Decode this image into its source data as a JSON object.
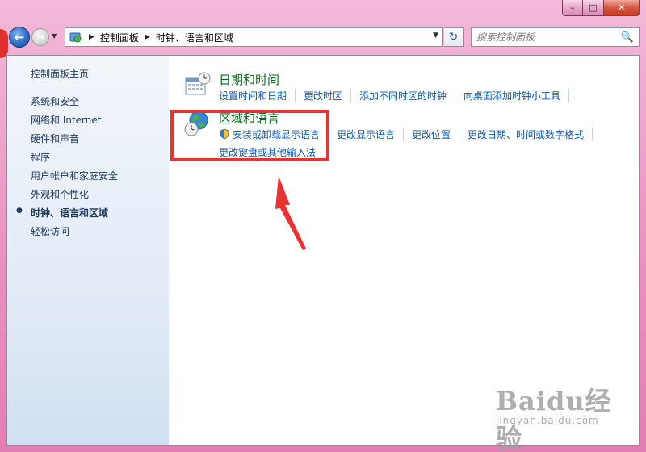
{
  "window": {
    "caption": {
      "minimize": "–",
      "maximize": "□",
      "close": "✕"
    }
  },
  "navigation": {
    "back_icon": "back-arrow-icon",
    "forward_icon": "forward-arrow-icon",
    "breadcrumbs": [
      "控制面板",
      "时钟、语言和区域"
    ],
    "search_placeholder": "搜索控制面板"
  },
  "sidebar": {
    "home": "控制面板主页",
    "items": [
      {
        "label": "系统和安全"
      },
      {
        "label": "网络和 Internet"
      },
      {
        "label": "硬件和声音"
      },
      {
        "label": "程序"
      },
      {
        "label": "用户帐户和家庭安全"
      },
      {
        "label": "外观和个性化"
      },
      {
        "label": "时钟、语言和区域",
        "current": true
      },
      {
        "label": "轻松访问"
      }
    ]
  },
  "categories": [
    {
      "title": "日期和时间",
      "icon": "calendar-clock-icon",
      "links": [
        "设置时间和日期",
        "更改时区",
        "添加不同时区的时钟",
        "向桌面添加时钟小工具"
      ]
    },
    {
      "title": "区域和语言",
      "icon": "globe-clock-icon",
      "links": [
        "安装或卸载显示语言",
        "更改显示语言",
        "更改位置",
        "更改日期、时间或数字格式"
      ],
      "links_row2": [
        "更改键盘或其他输入法"
      ]
    }
  ],
  "annotation": {
    "box_color": "#ea3232"
  },
  "watermark": {
    "main": "Baidu经验",
    "sub": "jingyan.baidu.com"
  }
}
